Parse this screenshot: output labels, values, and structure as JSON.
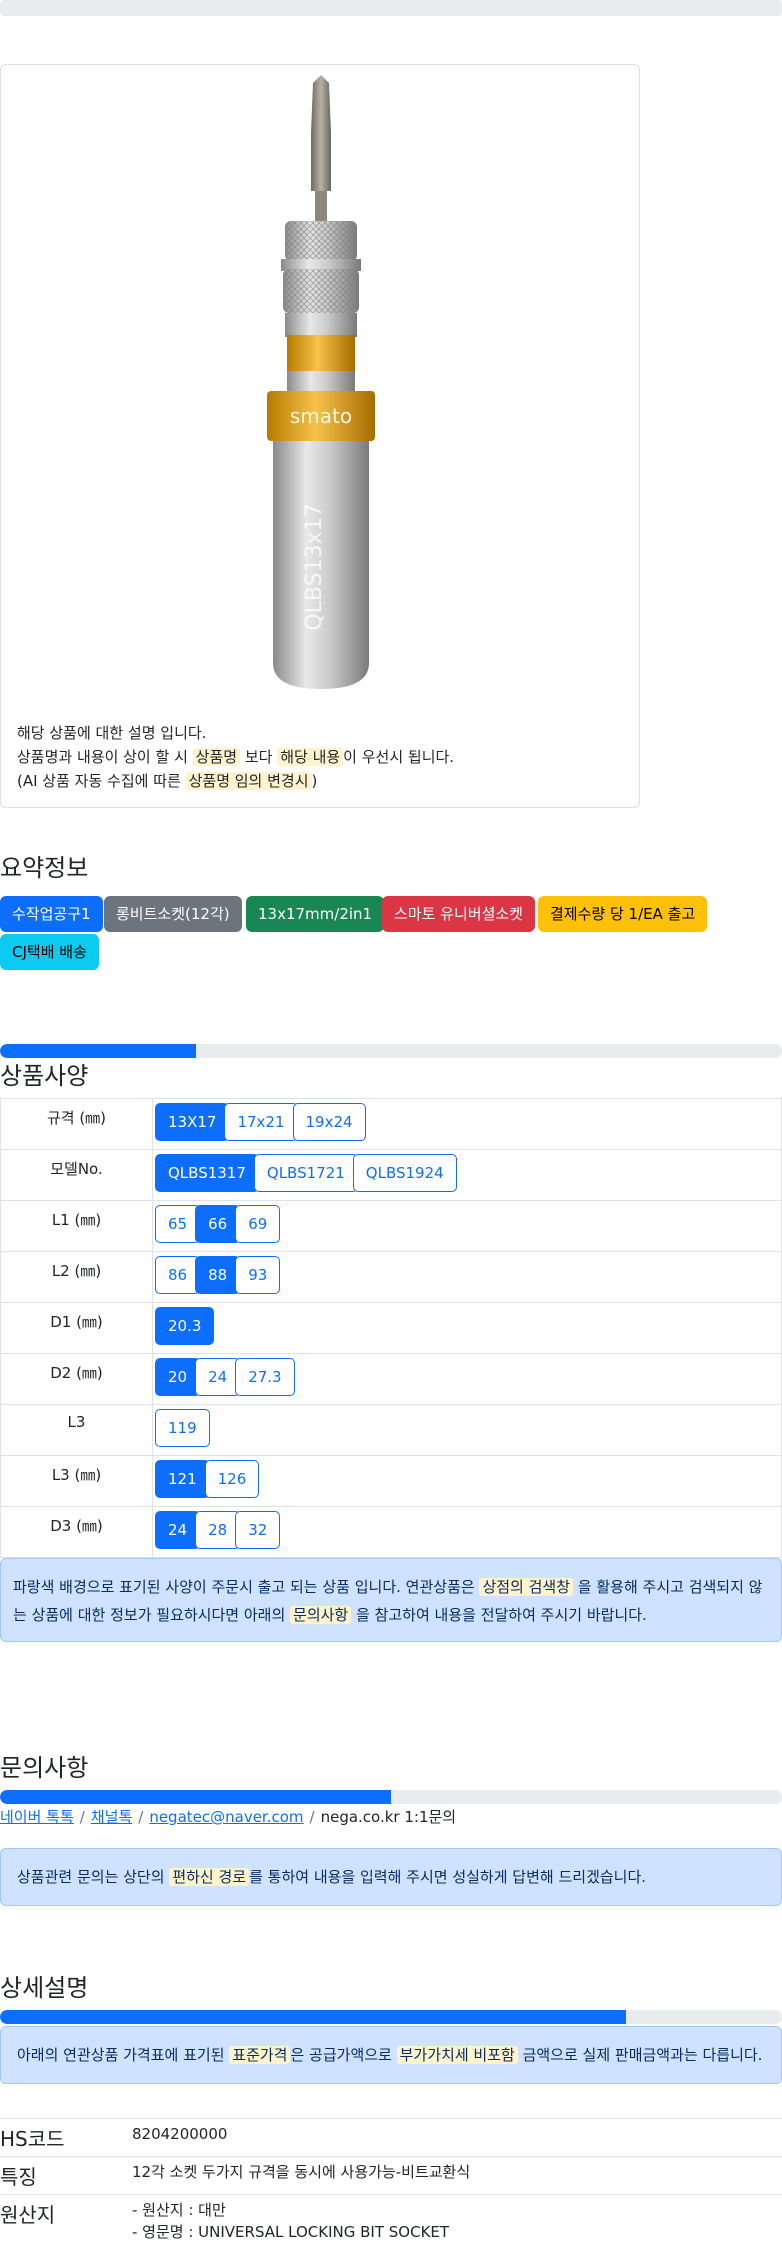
{
  "product": {
    "description_lines": [
      {
        "parts": [
          {
            "t": "해당 상품에 대한 설명 입니다."
          }
        ]
      },
      {
        "parts": [
          {
            "t": "상품명과 내용이 상이 할 시 "
          },
          {
            "t": "상품명",
            "hl": true
          },
          {
            "t": " 보다 "
          },
          {
            "t": "해당 내용",
            "hl": true
          },
          {
            "t": "이 우선시 됩니다."
          }
        ]
      },
      {
        "parts": [
          {
            "t": "(AI 상품 자동 수집에 따른 "
          },
          {
            "t": "상품명 임의 변경시",
            "hl": true
          },
          {
            "t": ")"
          }
        ]
      }
    ],
    "image_text": {
      "brand": "smato",
      "engraving": "QLBS13x17"
    }
  },
  "summary": {
    "title": "요약정보",
    "badges": [
      {
        "label": "수작업공구1",
        "color": "#0d6efd",
        "text": "#ffffff"
      },
      {
        "label": "롱비트소켓(12각)",
        "color": "#6c757d",
        "text": "#ffffff"
      },
      {
        "label": "13x17mm/2in1",
        "color": "#198754",
        "text": "#ffffff"
      },
      {
        "label": "스마토 유니버셜소켓",
        "color": "#dc3545",
        "text": "#ffffff"
      },
      {
        "label": "결제수량 당 1/EA 출고",
        "color": "#ffc107",
        "text": "#000000"
      },
      {
        "label": "CJ택배 배송",
        "color": "#0dcaf0",
        "text": "#000000"
      }
    ]
  },
  "spec": {
    "title": "상품사양",
    "progress": 0.25,
    "rows": [
      {
        "label": "규격 (㎜)",
        "options": [
          {
            "v": "13X17",
            "on": true
          },
          {
            "v": "17x21"
          },
          {
            "v": "19x24"
          }
        ]
      },
      {
        "label": "모델No.",
        "options": [
          {
            "v": "QLBS1317",
            "on": true
          },
          {
            "v": "QLBS1721"
          },
          {
            "v": "QLBS1924"
          }
        ]
      },
      {
        "label": "L1 (㎜)",
        "options": [
          {
            "v": "65"
          },
          {
            "v": "66",
            "on": true
          },
          {
            "v": "69"
          }
        ]
      },
      {
        "label": "L2 (㎜)",
        "options": [
          {
            "v": "86"
          },
          {
            "v": "88",
            "on": true
          },
          {
            "v": "93"
          }
        ]
      },
      {
        "label": "D1 (㎜)",
        "options": [
          {
            "v": "20.3",
            "on": true
          }
        ]
      },
      {
        "label": "D2 (㎜)",
        "options": [
          {
            "v": "20",
            "on": true
          },
          {
            "v": "24"
          },
          {
            "v": "27.3"
          }
        ]
      },
      {
        "label": "L3",
        "options": [
          {
            "v": "119"
          }
        ]
      },
      {
        "label": "L3 (㎜)",
        "options": [
          {
            "v": "121",
            "on": true
          },
          {
            "v": "126"
          }
        ]
      },
      {
        "label": "D3 (㎜)",
        "options": [
          {
            "v": "24",
            "on": true
          },
          {
            "v": "28"
          },
          {
            "v": "32"
          }
        ]
      }
    ],
    "notice_lines": [
      {
        "parts": [
          {
            "t": "파랑색 배경으로 표기된 사양이 주문시 출고 되는 상품 입니다. 연관상품은 "
          },
          {
            "t": "상점의 검색창",
            "hl": true
          },
          {
            "t": " 을 활용해 주시고 검색되지 않"
          }
        ]
      },
      {
        "parts": [
          {
            "t": "는 상품에 대한 정보가 필요하시다면 아래의 "
          },
          {
            "t": "문의사항",
            "hl": true
          },
          {
            "t": " 을 참고하여 내용을 전달하여 주시기 바랍니다."
          }
        ]
      }
    ]
  },
  "inquiry": {
    "title": "문의사항",
    "progress": 0.5,
    "links": [
      {
        "label": "네이버 톡톡",
        "link": true
      },
      {
        "label": "채널톡",
        "link": true
      },
      {
        "label": "negatec@naver.com",
        "link": true
      },
      {
        "label": "nega.co.kr 1:1문의",
        "link": false
      }
    ],
    "notice_parts": [
      {
        "t": "상품관련 문의는 상단의 "
      },
      {
        "t": "편하신 경로",
        "hl": true
      },
      {
        "t": "를 통하여 내용을 입력해 주시면 성실하게 답변해 드리겠습니다."
      }
    ]
  },
  "detail": {
    "title": "상세설명",
    "progress": 0.8,
    "notice_parts": [
      {
        "t": "아래의 연관상품 가격표에 표기된 "
      },
      {
        "t": "표준가격",
        "hl": true
      },
      {
        "t": "은 공급가액으로 "
      },
      {
        "t": "부가가치세 비포함",
        "hl": true
      },
      {
        "t": " 금액으로 실제 판매금액과는 다릅니다."
      }
    ],
    "info": [
      {
        "key": "HS코드",
        "values": [
          "8204200000"
        ]
      },
      {
        "key": "특징",
        "values": [
          "12각 소켓 두가지 규격을 동시에 사용가능-비트교환식"
        ]
      },
      {
        "key": "원산지",
        "values": [
          "- 원산지 : 대만",
          "- 영문명 : UNIVERSAL LOCKING BIT SOCKET"
        ]
      }
    ]
  }
}
